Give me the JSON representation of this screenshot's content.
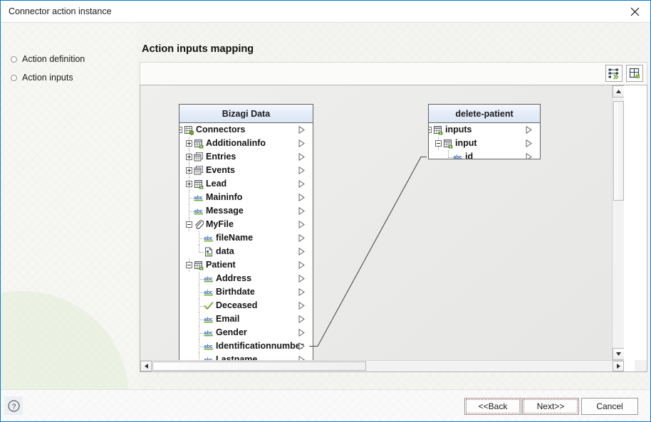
{
  "window": {
    "title": "Connector action instance",
    "close_icon": "close-icon"
  },
  "sidebar": {
    "items": [
      {
        "label": "Action definition"
      },
      {
        "label": "Action inputs"
      }
    ]
  },
  "main": {
    "page_title": "Action inputs mapping",
    "toolbar": {
      "buttons": [
        {
          "name": "mapping-options-button",
          "icon": "mapping-lines-icon"
        },
        {
          "name": "layout-button",
          "icon": "panel-layout-icon"
        }
      ]
    }
  },
  "diagram": {
    "source_panel": {
      "title": "Bizagi Data",
      "rows": [
        {
          "label": "Connectors",
          "indent": 0,
          "expander": "minus",
          "icon": "entity-collection-icon",
          "guide": "none",
          "port": true
        },
        {
          "label": "Additionalinfo",
          "indent": 1,
          "expander": "plus",
          "icon": "entity-icon",
          "guide": "vline",
          "port": true
        },
        {
          "label": "Entries",
          "indent": 1,
          "expander": "plus",
          "icon": "collection-icon",
          "guide": "vline",
          "port": true
        },
        {
          "label": "Events",
          "indent": 1,
          "expander": "plus",
          "icon": "collection-icon",
          "guide": "vline",
          "port": true
        },
        {
          "label": "Lead",
          "indent": 1,
          "expander": "plus",
          "icon": "entity-icon",
          "guide": "vline",
          "port": true
        },
        {
          "label": "Maininfo",
          "indent": 1,
          "expander": "none",
          "icon": "abc-icon",
          "guide": "tee",
          "port": true
        },
        {
          "label": "Message",
          "indent": 1,
          "expander": "none",
          "icon": "abc-icon",
          "guide": "tee",
          "port": true
        },
        {
          "label": "MyFile",
          "indent": 1,
          "expander": "minus",
          "icon": "paperclip-icon",
          "guide": "vline",
          "port": true
        },
        {
          "label": "fileName",
          "indent": 2,
          "expander": "none",
          "icon": "abc-icon",
          "guide": "tee",
          "port": true
        },
        {
          "label": "data",
          "indent": 2,
          "expander": "none",
          "icon": "document-icon",
          "guide": "elbow",
          "port": true
        },
        {
          "label": "Patient",
          "indent": 1,
          "expander": "minus",
          "icon": "entity-icon",
          "guide": "vline",
          "port": true
        },
        {
          "label": "Address",
          "indent": 2,
          "expander": "none",
          "icon": "abc-icon",
          "guide": "tee",
          "port": true
        },
        {
          "label": "Birthdate",
          "indent": 2,
          "expander": "none",
          "icon": "abc-icon",
          "guide": "tee",
          "port": true
        },
        {
          "label": "Deceased",
          "indent": 2,
          "expander": "none",
          "icon": "check-icon",
          "guide": "tee",
          "port": true
        },
        {
          "label": "Email",
          "indent": 2,
          "expander": "none",
          "icon": "abc-icon",
          "guide": "tee",
          "port": true
        },
        {
          "label": "Gender",
          "indent": 2,
          "expander": "none",
          "icon": "abc-icon",
          "guide": "tee",
          "port": true
        },
        {
          "label": "Identificationnumber",
          "indent": 2,
          "expander": "none",
          "icon": "abc-icon",
          "guide": "tee",
          "port": true
        },
        {
          "label": "Lastname",
          "indent": 2,
          "expander": "none",
          "icon": "abc-icon",
          "guide": "tee",
          "port": true
        }
      ]
    },
    "target_panel": {
      "title": "delete-patient",
      "rows": [
        {
          "label": "inputs",
          "indent": 0,
          "expander": "minus",
          "icon": "entity-icon",
          "guide": "none",
          "port": true
        },
        {
          "label": "input",
          "indent": 1,
          "expander": "minus",
          "icon": "entity-icon",
          "guide": "vline",
          "port": true
        },
        {
          "label": "id",
          "indent": 2,
          "expander": "none",
          "icon": "abc-icon",
          "guide": "elbow",
          "port": true
        }
      ]
    },
    "mapping": {
      "from_row": "Identificationnumber",
      "to_row": "id",
      "line_color": "#4a4a4a"
    }
  },
  "scrollbars": {
    "vertical": {
      "up_icon": "caret-up-icon",
      "down_icon": "caret-down-icon"
    },
    "horizontal": {
      "left_icon": "caret-left-icon",
      "right_icon": "caret-right-icon"
    }
  },
  "footer": {
    "help_icon": "help-circle-icon",
    "buttons": [
      {
        "name": "back-button",
        "label": "<<Back"
      },
      {
        "name": "next-button",
        "label": "Next>>"
      },
      {
        "name": "cancel-button",
        "label": "Cancel"
      }
    ]
  },
  "colors": {
    "accent_border": "#0a7cd4",
    "header_gradient_top": "#f4f7fd",
    "header_gradient_bottom": "#dbe6f6",
    "icon_green": "#6aa82b",
    "icon_blue": "#2b5fa8"
  }
}
